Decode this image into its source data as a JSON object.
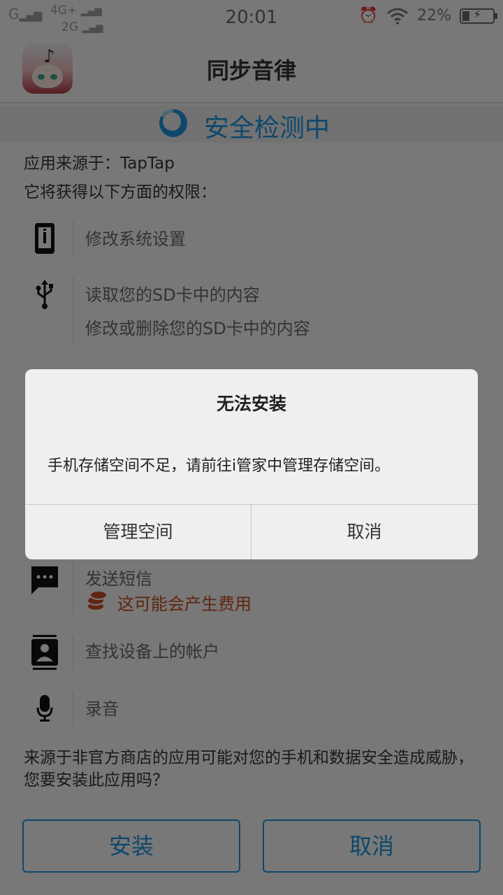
{
  "status_bar": {
    "carrier1": "G",
    "network_top": "4G+",
    "network_bottom": "2G",
    "time": "20:01",
    "battery_percent": "22%",
    "icons": [
      "signal-icon",
      "alarm-icon",
      "wifi-icon",
      "battery-charging-icon"
    ]
  },
  "header": {
    "app_name": "同步音律",
    "app_icon": "app-icon"
  },
  "scan": {
    "text": "安全检测中",
    "icon": "loading-spinner-icon"
  },
  "source_text": "应用来源于：TapTap",
  "permissions_intro": "它将获得以下方面的权限：",
  "permissions": [
    {
      "icon": "phone-settings-icon",
      "lines": [
        "修改系统设置"
      ]
    },
    {
      "icon": "usb-icon",
      "lines": [
        "读取您的SD卡中的内容",
        "修改或删除您的SD卡中的内容"
      ]
    },
    {
      "icon": "sms-icon",
      "lines": [
        "发送短信"
      ],
      "fee_note": "这可能会产生费用",
      "fee_icon": "coins-icon"
    },
    {
      "icon": "contacts-icon",
      "lines": [
        "查找设备上的帐户"
      ]
    },
    {
      "icon": "microphone-icon",
      "lines": [
        "录音"
      ]
    }
  ],
  "warning": "来源于非官方商店的应用可能对您的手机和数据安全造成威胁，您要安装此应用吗？",
  "buttons": {
    "install": "安装",
    "cancel": "取消"
  },
  "dialog": {
    "title": "无法安装",
    "message": "手机存储空间不足，请前往i管家中管理存储空间。",
    "manage_button": "管理空间",
    "cancel_button": "取消"
  },
  "colors": {
    "accent": "#1d8fd8",
    "fee": "#c24a22",
    "overlay": "rgba(0,0,0,0.5)"
  }
}
